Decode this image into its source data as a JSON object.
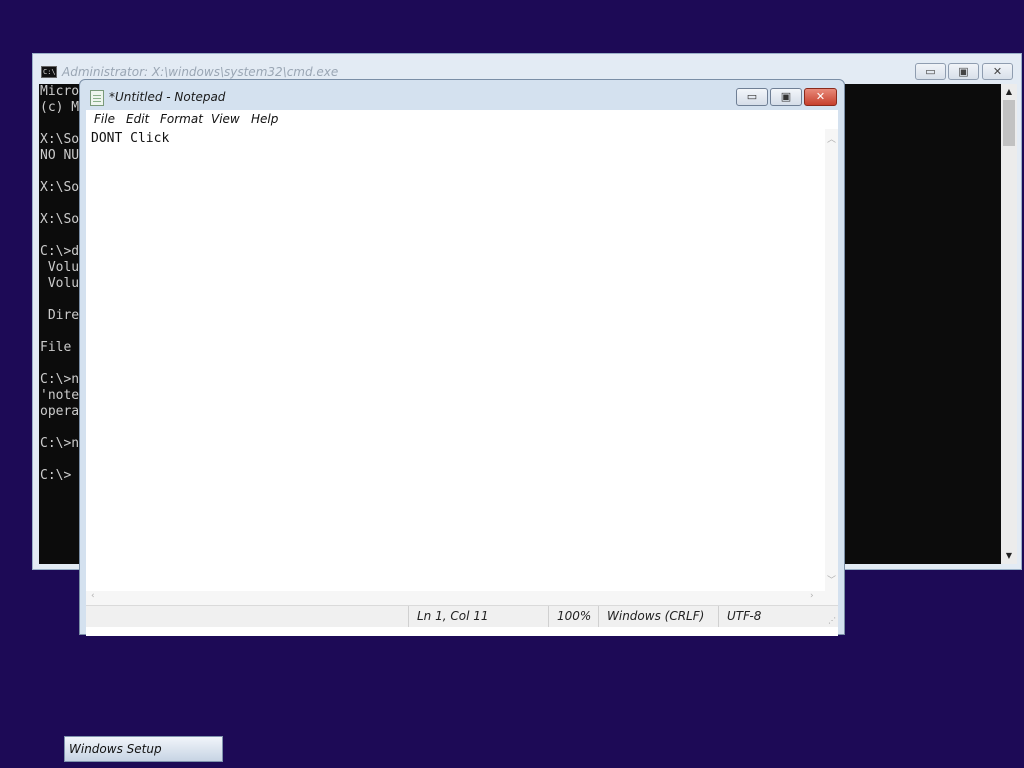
{
  "cmd": {
    "title": "Administrator: X:\\windows\\system32\\cmd.exe",
    "lines": [
      "Micro",
      "(c) M",
      "",
      "X:\\So",
      "NO NU",
      "",
      "X:\\So",
      "",
      "X:\\So",
      "",
      "C:\\>d",
      " Volu",
      " Volu",
      "",
      " Dire",
      "",
      "File ",
      "",
      "C:\\>n",
      "'note",
      "opera",
      "",
      "C:\\>n",
      "",
      "C:\\>"
    ],
    "minimize_symbol": "▭",
    "maximize_symbol": "▣",
    "close_symbol": "✕"
  },
  "notepad": {
    "title": "*Untitled - Notepad",
    "menu": [
      "File",
      "Edit",
      "Format",
      "View",
      "Help"
    ],
    "content": "DONT Click",
    "minimize_symbol": "▭",
    "maximize_symbol": "▣",
    "close_symbol": "✕",
    "status": {
      "position": "Ln 1, Col 11",
      "zoom": "100%",
      "line_ending": "Windows (CRLF)",
      "encoding": "UTF-8"
    }
  },
  "taskbar": {
    "item_label": "Windows Setup"
  },
  "colors": {
    "desktop": "#1d0a56",
    "cmd_background": "#0c0c0c",
    "cmd_text": "#cccccc"
  }
}
